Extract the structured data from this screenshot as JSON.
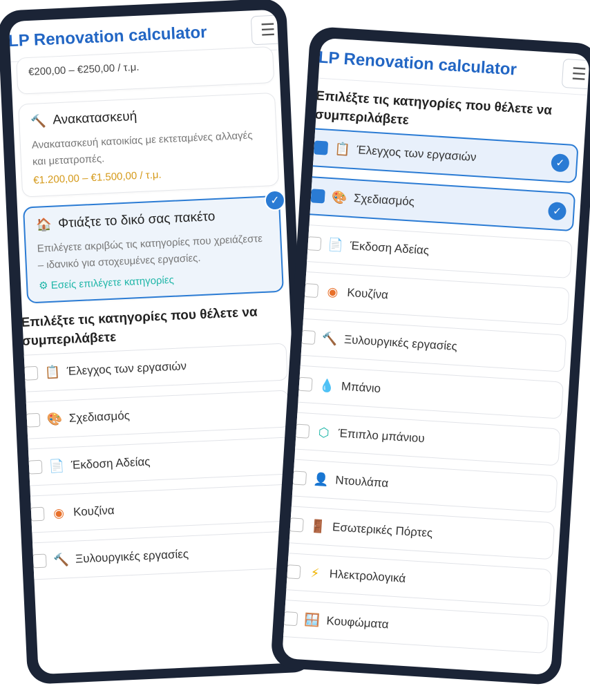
{
  "app": {
    "title": "LP Renovation calculator",
    "menu_icon": "hamburger-icon"
  },
  "left": {
    "price_top": "€200,00 – €250,00 / τ.μ.",
    "reno": {
      "title": "Ανακατασκευή",
      "desc": "Ανακατασκευή κατοικίας με εκτεταμένες αλλαγές και μετατροπές.",
      "price": "€1.200,00 – €1.500,00 / τ.μ."
    },
    "custom": {
      "title": "Φτιάξτε το δικό σας πακέτο",
      "desc": "Επιλέγετε ακριβώς τις κατηγορίες που χρειάζεστε – ιδανικό για στοχευμένες εργασίες.",
      "link": "Εσείς επιλέγετε κατηγορίες"
    },
    "section_title": "Επιλέξτε τις κατηγορίες που θέλετε να συμπεριλάβετε"
  },
  "categories": [
    {
      "label": "Έλεγχος των εργασιών",
      "icon": "clipboard-check-icon",
      "glyph": "📋",
      "color": "#2a7bd4",
      "selected_right": true
    },
    {
      "label": "Σχεδιασμός",
      "icon": "palette-icon",
      "glyph": "🎨",
      "color": "#e8a7b4",
      "selected_right": true
    },
    {
      "label": "Έκδοση Αδείας",
      "icon": "document-icon",
      "glyph": "📄",
      "color": "#2a7bd4",
      "selected_right": false
    },
    {
      "label": "Κουζίνα",
      "icon": "stove-icon",
      "glyph": "◉",
      "color": "#e8702a",
      "selected_right": false
    },
    {
      "label": "Ξυλουργικές εργασίες",
      "icon": "hammer-icon",
      "glyph": "🔨",
      "color": "#d59a1a",
      "selected_right": false
    },
    {
      "label": "Μπάνιο",
      "icon": "droplet-icon",
      "glyph": "💧",
      "color": "#2a7bd4",
      "selected_right": false
    },
    {
      "label": "Έπιπλο μπάνιου",
      "icon": "cube-icon",
      "glyph": "⬡",
      "color": "#1fb6a8",
      "selected_right": false
    },
    {
      "label": "Ντουλάπα",
      "icon": "person-icon",
      "glyph": "👤",
      "color": "#8a5cd6",
      "selected_right": false
    },
    {
      "label": "Εσωτερικές Πόρτες",
      "icon": "door-icon",
      "glyph": "🚪",
      "color": "#2fa05a",
      "selected_right": false
    },
    {
      "label": "Ηλεκτρολογικά",
      "icon": "lightning-icon",
      "glyph": "⚡",
      "color": "#f0b400",
      "selected_right": false
    },
    {
      "label": "Κουφώματα",
      "icon": "window-icon",
      "glyph": "🪟",
      "color": "#2fa05a",
      "selected_right": false
    }
  ],
  "right": {
    "section_title": "Επιλέξτε τις κατηγορίες που θέλετε να συμπεριλάβετε"
  },
  "colors": {
    "accent": "#2a7bd4",
    "title": "#2266c4",
    "price": "#d59a1a",
    "teal": "#1fb6a8",
    "frame": "#1b2436"
  }
}
